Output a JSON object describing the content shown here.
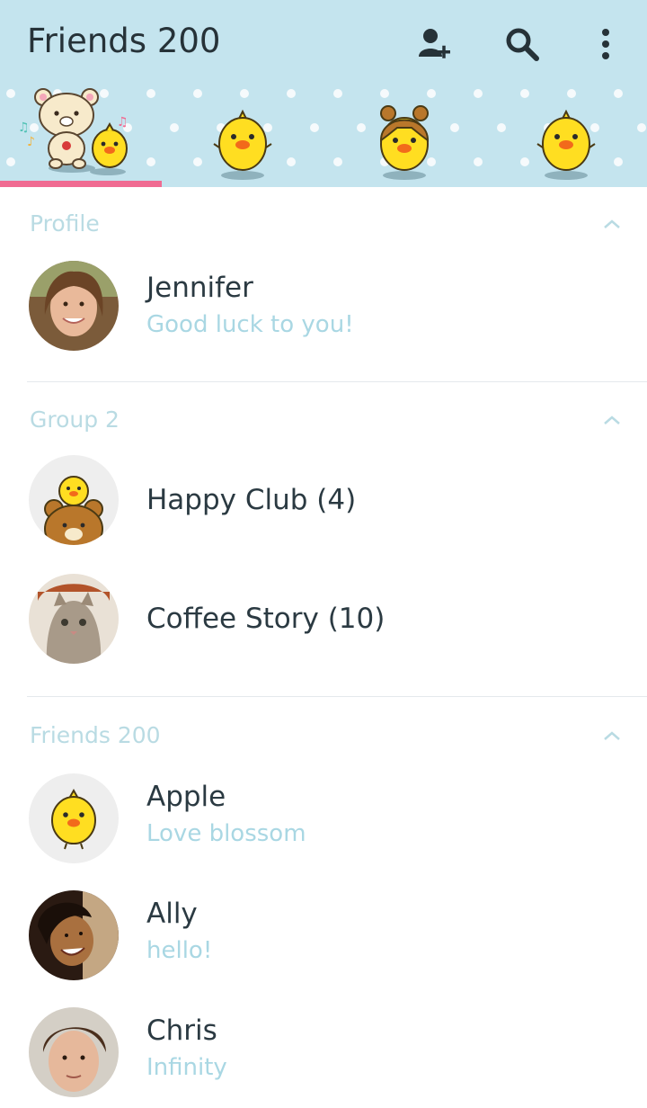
{
  "header": {
    "title": "Friends 200",
    "icons": {
      "add_friend": "add-friend-icon",
      "search": "search-icon",
      "more": "more-vert-icon"
    },
    "colors": {
      "background": "#c4e4ee",
      "tab_indicator": "#f06b92"
    }
  },
  "tabs": [
    {
      "name": "friends-tab",
      "selected": true
    },
    {
      "name": "chats-tab",
      "selected": false
    },
    {
      "name": "timeline-tab",
      "selected": false
    },
    {
      "name": "more-tab",
      "selected": false
    }
  ],
  "sections": {
    "profile": {
      "label": "Profile",
      "items": [
        {
          "name": "Jennifer",
          "status": "Good luck to you!"
        }
      ]
    },
    "groups": {
      "label": "Group 2",
      "items": [
        {
          "name": "Happy Club (4)"
        },
        {
          "name": "Coffee Story (10)"
        }
      ]
    },
    "friends": {
      "label": "Friends 200",
      "items": [
        {
          "name": "Apple",
          "status": "Love blossom"
        },
        {
          "name": "Ally",
          "status": "hello!"
        },
        {
          "name": "Chris",
          "status": "Infinity"
        }
      ]
    }
  },
  "colors": {
    "name": "#2b3a42",
    "status": "#a9d7e3",
    "section_label": "#b9dbe3"
  }
}
